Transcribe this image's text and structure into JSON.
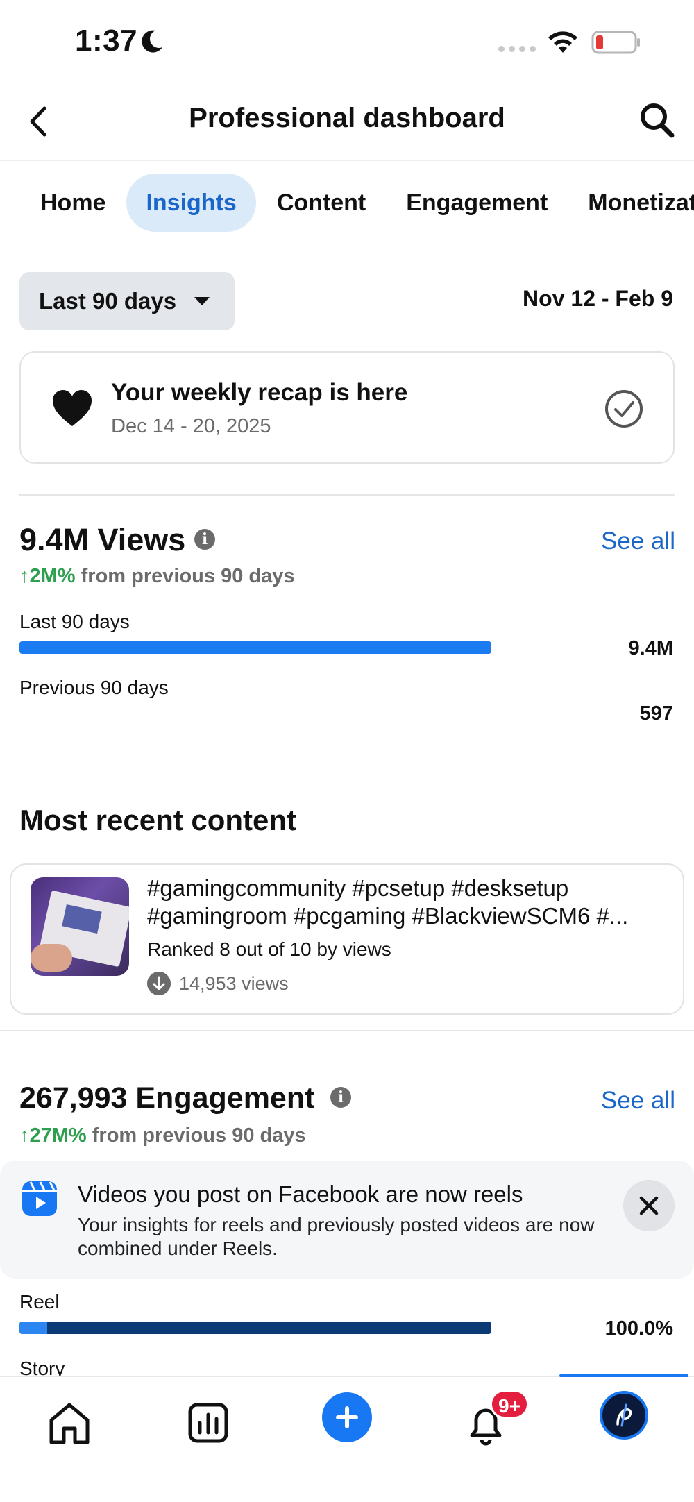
{
  "status_bar": {
    "time": "1:37"
  },
  "header": {
    "title": "Professional dashboard"
  },
  "tabs": [
    {
      "label": "Home",
      "active": false
    },
    {
      "label": "Insights",
      "active": true
    },
    {
      "label": "Content",
      "active": false
    },
    {
      "label": "Engagement",
      "active": false
    },
    {
      "label": "Monetizati",
      "active": false
    }
  ],
  "filter": {
    "range_label": "Last 90 days",
    "date_range": "Nov 12 - Feb 9"
  },
  "recap": {
    "title": "Your weekly recap is here",
    "dates": "Dec 14 - 20, 2025"
  },
  "views": {
    "title": "9.4M Views",
    "see_all": "See all",
    "delta_value": "↑2M%",
    "delta_text": "from previous 90 days",
    "bars": [
      {
        "label": "Last 90 days",
        "value": "9.4M",
        "fill_fraction": 1.0,
        "color": "#1b7cf2"
      },
      {
        "label": "Previous 90 days",
        "value": "597",
        "fill_fraction": 0.0,
        "color": "#1b7cf2"
      }
    ]
  },
  "recent": {
    "heading": "Most recent content",
    "line1": "#gamingcommunity #pcsetup #desksetup",
    "line2": "#gamingroom #pcgaming #BlackviewSCM6 #...",
    "rank": "Ranked 8 out of 10 by views",
    "views": "14,953 views"
  },
  "engagement": {
    "title": "267,993 Engagement",
    "see_all": "See all",
    "delta_value": "↑27M%",
    "delta_text": "from previous 90 days"
  },
  "notice": {
    "title": "Videos you post on Facebook are now reels",
    "body": "Your insights for reels and previously posted videos are now combined under Reels."
  },
  "breakdown": [
    {
      "label": "Reel",
      "value": "100.0%"
    },
    {
      "label": "Story",
      "value": ""
    }
  ],
  "bottom_nav": {
    "notification_badge": "9+"
  },
  "colors": {
    "accent": "#1877f2",
    "link": "#1a66c9",
    "positive": "#2e9e4f",
    "bar_dark": "#0b3a75"
  }
}
